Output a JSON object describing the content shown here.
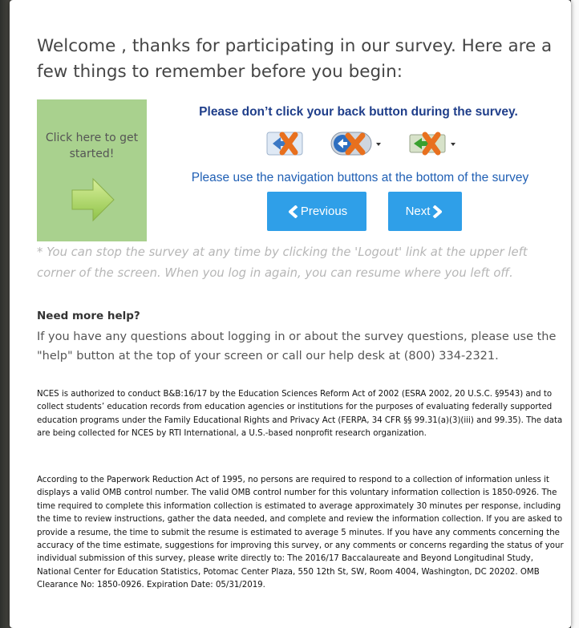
{
  "welcome": {
    "title": "Welcome , thanks for participating in our survey. Here are a few things to remember before you begin:"
  },
  "start": {
    "label": "Click here to get started!"
  },
  "back_warning": "Please don’t click your back button during the survey.",
  "back_icons": [
    "back-button-x-icon",
    "back-dropdown-x-icon",
    "green-back-x-icon"
  ],
  "nav_instruction": "Please use the navigation buttons at the bottom of the survey",
  "buttons": {
    "previous": "Previous",
    "next": "Next"
  },
  "logout_note": "* You can stop the survey at any time by clicking the 'Logout' link at the upper left corner of the screen. When you log in again, you can resume where you left off.",
  "help": {
    "heading": "Need more help?",
    "body": "If you have any questions about logging in or about the survey questions, please use the \"help\" button at the top of your screen or call our help desk at (800) 334-2321."
  },
  "legal": {
    "authority": "NCES is authorized to conduct B&B:16/17 by the Education Sciences Reform Act of 2002 (ESRA 2002, 20 U.S.C. §9543) and to collect students’ education records from education agencies or institutions for the purposes of evaluating federally supported education programs under the Family Educational Rights and Privacy Act (FERPA, 34 CFR §§ 99.31(a)(3)(iii) and 99.35). The data are being collected for NCES by RTI International, a U.S.-based nonprofit research organization.",
    "paperwork": "According to the Paperwork Reduction Act of 1995, no persons are required to respond to a collection of information unless it displays a valid OMB control number. The valid OMB control number for this voluntary information collection is 1850-0926. The time required to complete this information collection is estimated to average approximately 30 minutes per response, including the time to review instructions, gather the data needed, and complete and review the information collection. If you are asked to provide a resume, the time to submit the resume is estimated to average 5 minutes. If you have any comments concerning the accuracy of the time estimate, suggestions for improving this survey, or any comments or concerns regarding the status of your individual submission of this survey, please write directly to: The 2016/17 Baccalaureate and Beyond Longitudinal Study, National Center for Education Statistics, Potomac Center Plaza, 550 12th St, SW, Room 4004, Washington, DC 20202. OMB Clearance No: 1850-0926. Expiration Date: 05/31/2019."
  },
  "colors": {
    "start_panel": "#a9d18e",
    "nav_button": "#2f9fe8",
    "warning_text": "#1f3e8a",
    "instruction_text": "#1f5fb4"
  }
}
